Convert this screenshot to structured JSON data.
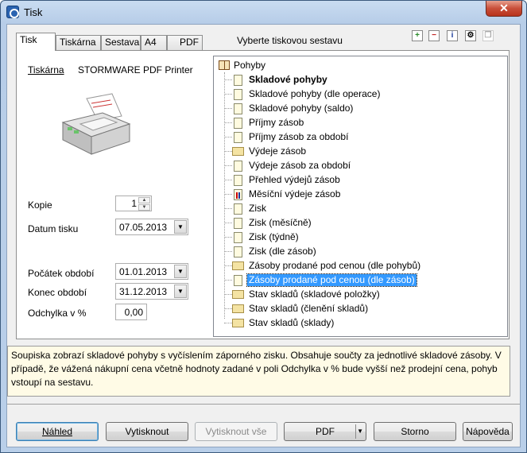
{
  "window": {
    "title": "Tisk",
    "close": "✕"
  },
  "tabs": [
    "Tisk",
    "Tiskárna",
    "Sestava",
    "A4",
    "PDF"
  ],
  "header": {
    "choose_report": "Vyberte tiskovou sestavu"
  },
  "printer": {
    "label": "Tiskárna",
    "value": "STORMWARE PDF Printer"
  },
  "form": {
    "copies_label": "Kopie",
    "copies": "1",
    "print_date_label": "Datum tisku",
    "print_date": "07.05.2013",
    "period_start_label": "Počátek období",
    "period_start": "01.01.2013",
    "period_end_label": "Konec období",
    "period_end": "31.12.2013",
    "deviation_label": "Odchylka v %",
    "deviation": "0,00"
  },
  "tree": {
    "root": "Pohyby",
    "items": [
      "Skladové pohyby",
      "Skladové pohyby (dle operace)",
      "Skladové pohyby (saldo)",
      "Příjmy zásob",
      "Příjmy zásob za období",
      "Výdeje zásob",
      "Výdeje zásob za období",
      "Přehled výdejů zásob",
      "Měsíční výdeje zásob",
      "Zisk",
      "Zisk (měsíčně)",
      "Zisk (týdně)",
      "Zisk (dle zásob)",
      "Zásoby prodané pod cenou (dle pohybů)",
      "Zásoby prodané pod cenou (dle zásob)",
      "Stav skladů (skladové položky)",
      "Stav skladů (členění skladů)",
      "Stav skladů (sklady)"
    ]
  },
  "description": "Soupiska zobrazí skladové pohyby s vyčíslením záporného zisku. Obsahuje součty za jednotlivé skladové zásoby. V případě, že vážená nákupní cena včetně hodnoty zadané v poli Odchylka v % bude vyšší než prodejní cena, pohyb vstoupí na sestavu.",
  "buttons": {
    "preview": "Náhled",
    "print": "Vytisknout",
    "print_all": "Vytisknout vše",
    "pdf": "PDF",
    "cancel": "Storno",
    "help": "Nápověda"
  }
}
